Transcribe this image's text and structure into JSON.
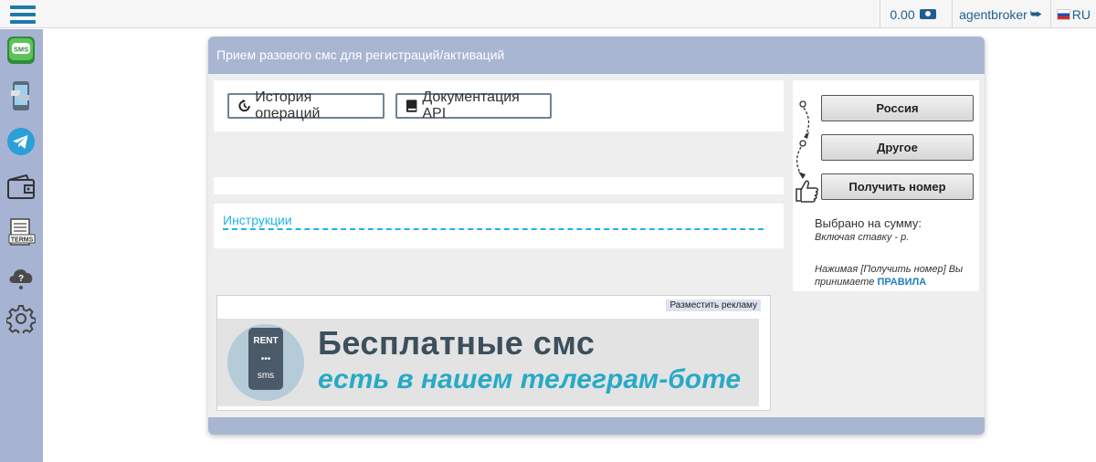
{
  "topbar": {
    "balance": "0.00",
    "username": "agentbroker",
    "lang": "RU"
  },
  "sidebar": {
    "items": [
      {
        "name": "sms",
        "label": "SMS"
      },
      {
        "name": "phone"
      },
      {
        "name": "telegram"
      },
      {
        "name": "wallet"
      },
      {
        "name": "terms",
        "label": "TERMS"
      },
      {
        "name": "support"
      },
      {
        "name": "settings"
      }
    ]
  },
  "panel": {
    "title": "Прием разового смс для регистраций/активаций",
    "history_label": "История операций",
    "api_docs_label": "Документация API",
    "instructions_label": "Инструкции",
    "ad": {
      "place_ad_label": "Разместить рекламу",
      "rent_label": "RENT",
      "sms_label": "sms",
      "line1": "Бесплатные смс",
      "line2": "есть в нашем телеграм-боте"
    }
  },
  "order": {
    "country_button": "Россия",
    "service_button": "Другое",
    "get_number_button": "Получить номер",
    "selected_sum_label": "Выбрано на сумму:",
    "rate_note": "Включая ставку - р.",
    "agreement_text": "Нажимая [Получить номер] Вы принимаете",
    "rules_link": "ПРАВИЛА"
  },
  "colors": {
    "accent": "#1f79a8",
    "panel_header": "#a9b6d2",
    "sidebar": "#a7b3d3",
    "link": "#1eb4e6"
  }
}
